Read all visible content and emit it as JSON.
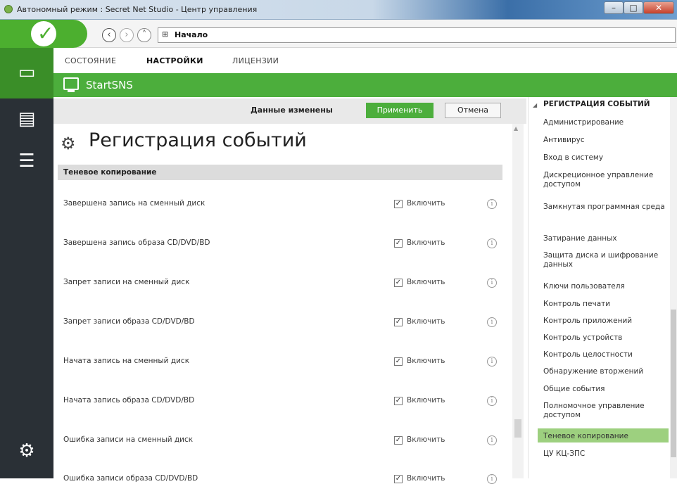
{
  "window": {
    "title": "Автономный режим : Secret Net Studio - Центр управления"
  },
  "address": {
    "path": "Начало"
  },
  "tabs": [
    {
      "label": "СОСТОЯНИЕ"
    },
    {
      "label": "НАСТРОЙКИ",
      "active": true
    },
    {
      "label": "ЛИЦЕНЗИИ"
    }
  ],
  "banner": {
    "title": "StartSNS"
  },
  "actionbar": {
    "status": "Данные изменены",
    "apply": "Применить",
    "cancel": "Отмена"
  },
  "page": {
    "title": "Регистрация событий",
    "section": "Теневое копирование",
    "rows": [
      {
        "label": "Завершена запись на сменный диск",
        "checkbox": "Включить",
        "checked": true
      },
      {
        "label": "Завершена запись образа CD/DVD/BD",
        "checkbox": "Включить",
        "checked": true
      },
      {
        "label": "Запрет записи на сменный диск",
        "checkbox": "Включить",
        "checked": true
      },
      {
        "label": "Запрет записи образа CD/DVD/BD",
        "checkbox": "Включить",
        "checked": true
      },
      {
        "label": "Начата запись на сменный диск",
        "checkbox": "Включить",
        "checked": true
      },
      {
        "label": "Начата запись образа CD/DVD/BD",
        "checkbox": "Включить",
        "checked": true
      },
      {
        "label": "Ошибка записи на сменный диск",
        "checkbox": "Включить",
        "checked": true
      },
      {
        "label": "Ошибка записи образа CD/DVD/BD",
        "checkbox": "Включить",
        "checked": true
      }
    ]
  },
  "nav": {
    "header": "РЕГИСТРАЦИЯ СОБЫТИЙ",
    "items": [
      {
        "label": "Администрирование"
      },
      {
        "label": "Антивирус"
      },
      {
        "label": "Вход в систему"
      },
      {
        "label": "Дискреционное управление доступом"
      },
      {
        "label": "Замкнутая программная среда"
      },
      {
        "label": "Затирание данных"
      },
      {
        "label": "Защита диска и шифрование данных"
      },
      {
        "label": "Ключи пользователя"
      },
      {
        "label": "Контроль печати"
      },
      {
        "label": "Контроль приложений"
      },
      {
        "label": "Контроль устройств"
      },
      {
        "label": "Контроль целостности"
      },
      {
        "label": "Обнаружение вторжений"
      },
      {
        "label": "Общие события"
      },
      {
        "label": "Полномочное управление доступом"
      },
      {
        "label": "Теневое копирование",
        "active": true
      },
      {
        "label": "ЦУ КЦ-ЗПС"
      }
    ]
  },
  "icons": {
    "home": "checkmark-icon",
    "back": "back-arrow-icon",
    "forward": "forward-arrow-icon",
    "up": "up-arrow-icon",
    "path": "network-icon",
    "rail": [
      "monitor-icon",
      "chip-icon",
      "server-icon",
      "gear-icon"
    ],
    "page": "event-log-icon",
    "info": "info-icon"
  },
  "colors": {
    "accent": "#4cae3c",
    "active_item": "#9dd07f",
    "rail": "#2a3036",
    "rail_active": "#3a8e28"
  }
}
